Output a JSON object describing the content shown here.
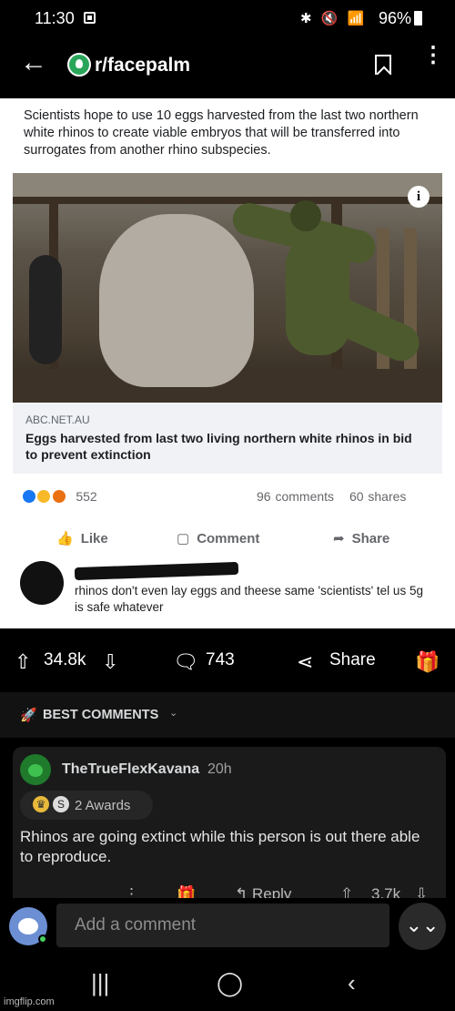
{
  "status_bar": {
    "time": "11:30",
    "icons": "✱ 🔇 📶",
    "battery": "96%"
  },
  "header": {
    "back_icon": "arrow-left-icon",
    "subreddit": "r/facepalm",
    "bookmark_icon": "bookmark-icon",
    "more_icon": "more-vertical-icon"
  },
  "post_image": {
    "caption": "Scientists hope to use 10 eggs harvested from the last two northern white rhinos to create viable embryos that will be transferred into surrogates from another rhino subspecies.",
    "info_glyph": "i",
    "link_domain": "ABC.NET.AU",
    "link_title": "Eggs harvested from last two living northern white rhinos in bid to prevent extinction",
    "reaction_count": "552",
    "comments": "96 comments",
    "shares": "60 shares",
    "like_label": "Like",
    "comment_label": "Comment",
    "share_label": "Share",
    "fb_comment_text": "rhinos don't even lay eggs and theese same 'scientists' tel us 5g is safe whatever"
  },
  "post_actions": {
    "votes": "34.8k",
    "comments": "743",
    "share_label": "Share"
  },
  "sort": {
    "label": "BEST COMMENTS"
  },
  "comment": {
    "username": "TheTrueFlexKavana",
    "time": "20h",
    "awards": "2 Awards",
    "body": "Rhinos are going extinct while this person is out there able to reproduce.",
    "reply_label": "Reply",
    "votes": "3.7k"
  },
  "compose": {
    "placeholder": "Add a comment"
  },
  "watermark": "imgflip.com",
  "colors": {
    "background": "#000000",
    "card": "#1a1a1a",
    "online": "#46d160",
    "fb_like": "#1877f2"
  }
}
